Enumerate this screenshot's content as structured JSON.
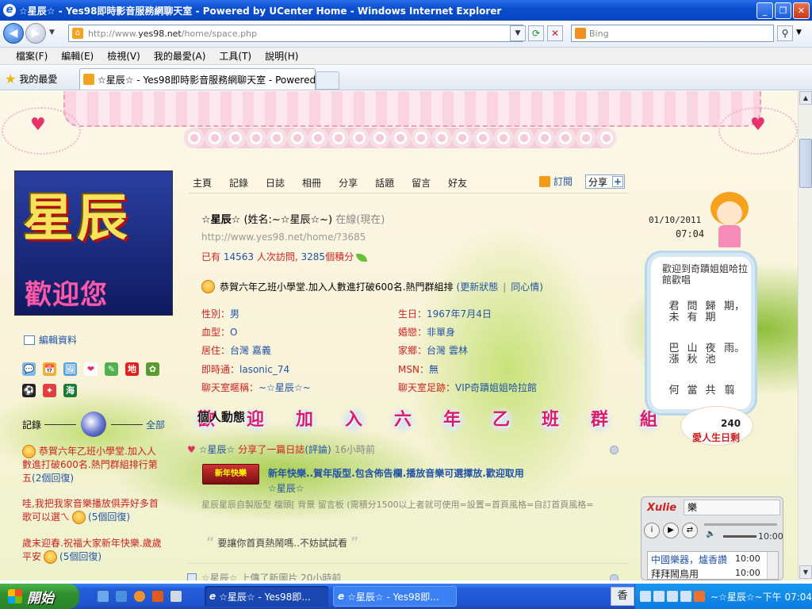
{
  "window": {
    "title": "☆星辰☆ - Yes98即時影音服務網聊天室 - Powered by UCenter Home - Windows Internet Explorer",
    "min": "_",
    "max": "❐",
    "close": "✕"
  },
  "address": {
    "url_prefix": "http://www.",
    "url_domain": "yes98.net",
    "url_path": "/home/space.php",
    "search_placeholder": "Bing"
  },
  "menu": [
    "檔案(F)",
    "編輯(E)",
    "檢視(V)",
    "我的最愛(A)",
    "工具(T)",
    "說明(H)"
  ],
  "favorites": {
    "label": "我的最愛",
    "tab_title": "☆星辰☆ - Yes98即時影音服務網聊天室 - Powered..."
  },
  "profile": {
    "avatar_big": "星辰",
    "avatar_sub": "歡迎您",
    "edit_link": "編輯資料",
    "nav": [
      "主頁",
      "記錄",
      "日誌",
      "相冊",
      "分享",
      "話題",
      "留言",
      "好友"
    ],
    "subscribe": "訂閱",
    "share": "分享",
    "share_plus": "+",
    "name": "☆星辰☆",
    "alias": "(姓名:~☆星辰☆~)",
    "online": "在線(現在)",
    "space_url": "http://www.yes98.net/home/?3685",
    "visits_pre": "已有",
    "visits_num": "14563",
    "visits_mid": "人次訪問,",
    "points_num": "3285",
    "points_suf": "個積分",
    "status_text": "恭賀六年乙班小學堂.加入人數進打破600名.熱門群組排",
    "status_update": "(更新狀態",
    "status_sep": "|",
    "status_agree": "同心情)",
    "fields_left": [
      {
        "k": "性別：",
        "v": "男"
      },
      {
        "k": "血型：",
        "v": "O"
      },
      {
        "k": "居住：",
        "v": "台灣 嘉義"
      },
      {
        "k": "即時通：",
        "v": "lasonic_74"
      },
      {
        "k": "聊天室暱稱：",
        "v": "~☆星辰☆~"
      }
    ],
    "fields_right": [
      {
        "k": "生日：",
        "v": "1967年7月4日"
      },
      {
        "k": "婚戀：",
        "v": "非單身"
      },
      {
        "k": "家鄉：",
        "v": "台灣 雲林"
      },
      {
        "k": "MSN：",
        "v": "無"
      },
      {
        "k": "聊天室足跡：",
        "v": "VIP奇蹟姐姐哈拉館"
      }
    ]
  },
  "left": {
    "record_label": "記錄",
    "all_label": "全部",
    "app_icons": [
      "chat-icon",
      "calendar-icon",
      "photo-icon",
      "heart-icon",
      "pencil-icon",
      "map-icon",
      "plant-icon",
      "ball-icon",
      "rabbit-icon",
      "sea-icon"
    ],
    "app_glyphs": [
      "💬",
      "📅",
      "🖼",
      "❤",
      "✎",
      "地",
      "✿",
      "⚽",
      "✦",
      "海"
    ],
    "entries": [
      {
        "text": "恭賀六年乙班小學堂.加入人數進打破600名.熱門群組排行第五",
        "reply": "(2個回復)"
      },
      {
        "text": "哇,我把我家音樂播放俱弄好多首歌可以選ㄟ",
        "reply": "(5個回復)"
      },
      {
        "text": "歲末迎春.祝福大家新年快樂.歲歲平安",
        "reply": "(5個回復)"
      }
    ]
  },
  "activity": {
    "title": "個人動態",
    "ticker": [
      "歡",
      "迎",
      "加",
      "入",
      "六",
      "年",
      "乙",
      "班",
      "群",
      "組"
    ],
    "feed1_actor": "☆星辰☆",
    "feed1_action": "分享了一篇日誌",
    "feed1_comment": "(評論)",
    "feed1_time": "16小時前",
    "thumb_label": "新年快樂",
    "post_title": "新年快樂..賀年版型.包含佈告欄.播放音樂可選擇放.歡迎取用",
    "post_author": "☆星辰☆",
    "post_desc": "星辰星辰自製版型  檔頭[  背景  留言板 (需積分1500以上者就可使用=設置=首頁風格=自訂首頁風格=",
    "quote": "要讓你首頁熱鬧嗎..不妨試試看",
    "quote_open": "“",
    "quote_close": "”",
    "feed2": "☆星辰☆ 上傳了新圖片 20小時前"
  },
  "widget": {
    "date": "01/10/2011",
    "time": "07:04",
    "poem_title": "歡迎到奇蹟姐姐哈拉館歡唱",
    "poem_cols": [
      "期，",
      "歸期",
      "問有",
      "君未",
      "雨。",
      "夜池",
      "山秋",
      "巴漲",
      "翦",
      "共",
      "當",
      "何"
    ],
    "count_num": "240",
    "count_label": "愛人生日剩"
  },
  "player": {
    "brand": "Xulie",
    "search": "樂",
    "time": "10:00",
    "list": [
      {
        "title": "中國樂器，爐香讚",
        "time": "10:00"
      },
      {
        "title": "拜拜鬧鳥用",
        "time": "10:00"
      }
    ],
    "vol": "🔈"
  },
  "taskbar": {
    "start": "開始",
    "tasks": [
      "☆星辰☆ - Yes98即...",
      "☆星辰☆ - Yes98即..."
    ],
    "ime": "香",
    "tray_text": "~☆星辰☆~下午 07:04"
  }
}
